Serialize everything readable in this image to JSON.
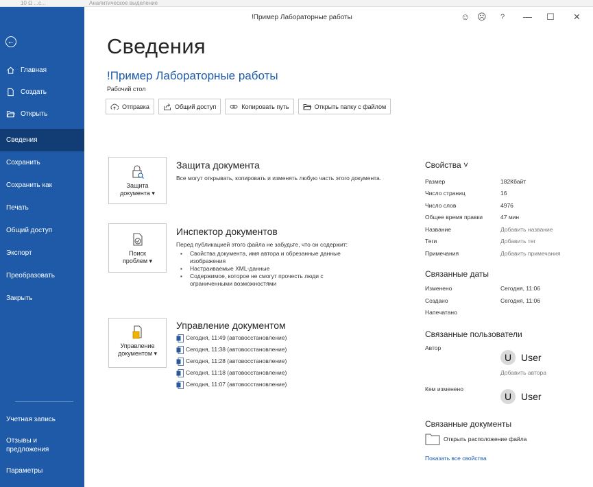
{
  "top_strip": {
    "text_left": "10  Ω ...с...",
    "text_mid": "Аналитическое выделение"
  },
  "window": {
    "title": "!Пример Лабораторные работы",
    "controls": {
      "smile": "☺",
      "frown": "☹",
      "help": "?",
      "minimize": "—",
      "maximize": "☐",
      "close": "✕"
    }
  },
  "sidebar": {
    "back_label": "Назад",
    "top_items": [
      {
        "label": "Главная",
        "icon": "home-icon"
      },
      {
        "label": "Создать",
        "icon": "new-doc-icon"
      },
      {
        "label": "Открыть",
        "icon": "open-folder-icon"
      }
    ],
    "main_items": [
      {
        "label": "Сведения",
        "active": true
      },
      {
        "label": "Сохранить"
      },
      {
        "label": "Сохранить как"
      },
      {
        "label": "Печать"
      },
      {
        "label": "Общий доступ"
      },
      {
        "label": "Экспорт"
      },
      {
        "label": "Преобразовать"
      },
      {
        "label": "Закрыть"
      }
    ],
    "bottom_items": [
      {
        "label": "Учетная запись"
      },
      {
        "label": "Отзывы и предложения"
      },
      {
        "label": "Параметры"
      }
    ]
  },
  "main": {
    "page_title": "Сведения",
    "doc_name": "!Пример Лабораторные работы",
    "doc_location": "Рабочий стол",
    "buttons": [
      {
        "label": "Отправка",
        "icon": "upload-icon"
      },
      {
        "label": "Общий доступ",
        "icon": "share-icon"
      },
      {
        "label": "Копировать путь",
        "icon": "link-icon"
      },
      {
        "label": "Открыть папку с файлом",
        "icon": "folder-icon"
      }
    ],
    "protect": {
      "card_label_1": "Защита",
      "card_label_2": "документа ▾",
      "title": "Защита документа",
      "text": "Все могут открывать, копировать и изменять любую часть этого документа."
    },
    "inspect": {
      "card_label_1": "Поиск",
      "card_label_2": "проблем ▾",
      "title": "Инспектор документов",
      "intro": "Перед публикацией этого файла не забудьте, что он содержит:",
      "bullets": [
        "Свойства документа, имя автора и обрезанные данные изображения",
        "Настраиваемые XML-данные",
        "Содержимое, которое не смогут прочесть люди с ограниченными возможностями"
      ]
    },
    "manage": {
      "card_label_1": "Управление",
      "card_label_2": "документом ▾",
      "title": "Управление документом",
      "versions": [
        "Сегодня, 11:49 (автовосстановление)",
        "Сегодня, 11:38 (автовосстановление)",
        "Сегодня, 11:28 (автовосстановление)",
        "Сегодня, 11:18 (автовосстановление)",
        "Сегодня, 11:07 (автовосстановление)"
      ]
    }
  },
  "properties": {
    "header": "Свойства ˅",
    "rows": [
      {
        "k": "Размер",
        "v": "182Кбайт",
        "muted": false
      },
      {
        "k": "Число страниц",
        "v": "16",
        "muted": false
      },
      {
        "k": "Число слов",
        "v": "4976",
        "muted": false
      },
      {
        "k": "Общее время правки",
        "v": "47 мин",
        "muted": false
      },
      {
        "k": "Название",
        "v": "Добавить название",
        "muted": true
      },
      {
        "k": "Теги",
        "v": "Добавить тег",
        "muted": true
      },
      {
        "k": "Примечания",
        "v": "Добавить примечания",
        "muted": true
      }
    ],
    "dates_header": "Связанные даты",
    "dates": [
      {
        "k": "Изменено",
        "v": "Сегодня, 11:06"
      },
      {
        "k": "Создано",
        "v": "Сегодня, 11:06"
      },
      {
        "k": "Напечатано",
        "v": ""
      }
    ],
    "people_header": "Связанные пользователи",
    "author_label": "Автор",
    "author_initial": "U",
    "author_name": "User",
    "add_author": "Добавить автора",
    "modified_by_label": "Кем изменено",
    "modified_initial": "U",
    "modified_name": "User",
    "docs_header": "Связанные документы",
    "open_location": "Открыть расположение файла",
    "show_all": "Показать все свойства"
  }
}
